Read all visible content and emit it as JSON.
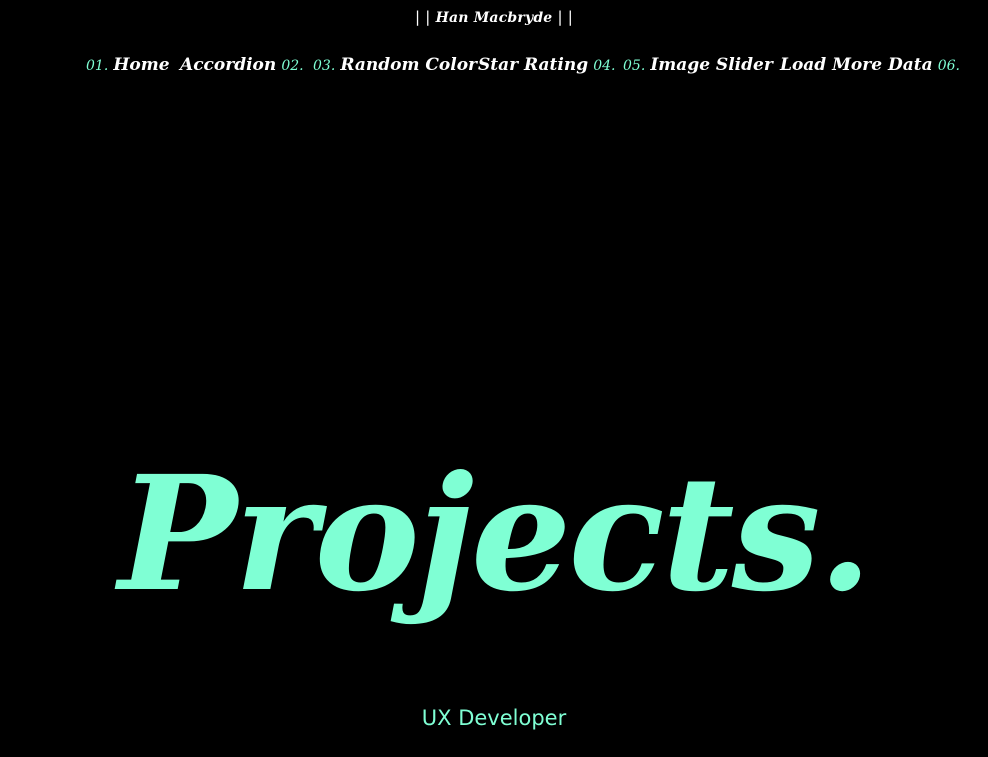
{
  "brand": {
    "left_bar": "| |",
    "name": "Han Macbryde",
    "right_bar": "| |"
  },
  "nav": {
    "items": [
      {
        "number": "01.",
        "label": "Home",
        "number_first": true
      },
      {
        "number": "02.",
        "label": "Accordion",
        "number_first": false
      },
      {
        "number": "03.",
        "label": "Random Color",
        "number_first": true
      },
      {
        "number": "04.",
        "label": "Star Rating",
        "number_first": false
      },
      {
        "number": "05.",
        "label": "Image Slider",
        "number_first": true
      },
      {
        "number": "06.",
        "label": "Load More Data",
        "number_first": false
      }
    ]
  },
  "hero": {
    "title": "Projects.",
    "subtitle": "UX Developer"
  },
  "colors": {
    "background": "#000000",
    "accent": "#7fffd4",
    "text": "#ffffff"
  }
}
